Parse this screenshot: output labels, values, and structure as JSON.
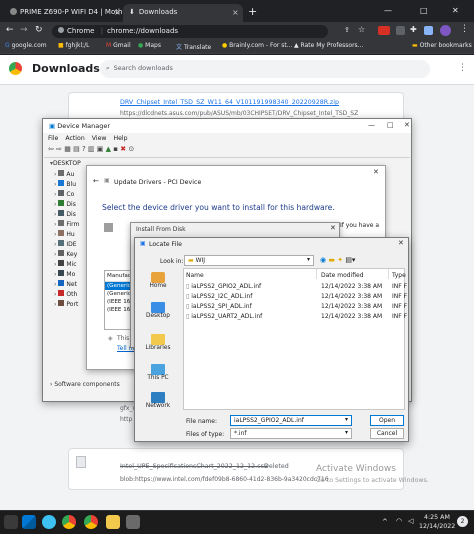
{
  "browser": {
    "tabs": [
      {
        "title": "PRIME Z690-P WIFI D4 | Mothe",
        "close": "×"
      },
      {
        "title": "Downloads",
        "close": "×"
      }
    ],
    "new_tab": "+",
    "window_controls": [
      "—",
      "□",
      "✕"
    ],
    "omnibox": {
      "chip": "Chrome",
      "url": "chrome://downloads"
    },
    "bookmarks": [
      "google.com",
      "fghjkl;/L",
      "Gmail",
      "Maps",
      "Translate",
      "Brainly.com - For st...",
      "Rate My Professors...",
      "Other bookmarks"
    ]
  },
  "downloads": {
    "title": "Downloads",
    "search_placeholder": "Search downloads",
    "item1": {
      "name": "DRV_Chipset_Intel_TSD_SZ_W11_64_V101191998340_20220928R.zip",
      "url": "https://dlcdnets.asus.com/pub/ASUS/mb/03CHIPSET/DRV_Chipset_Intel_TSD_SZ"
    },
    "item2": {
      "name": "Intel_UPE_SpecificationsChart_2022_12_12.csv",
      "status": "Deleted",
      "url": "blob:https://www.intel.com/fdef09b8-6860-41d2-836b-9a3420cdc716"
    },
    "partial_left_1": "gfx_w",
    "partial_left_2": "http"
  },
  "device_manager": {
    "title": "Device Manager",
    "menu": [
      "File",
      "Action",
      "View",
      "Help"
    ],
    "root": "DESKTOP",
    "tree": [
      "Au",
      "Blu",
      "Co",
      "Dis",
      "Dis",
      "Firm",
      "Hu",
      "IDE",
      "Key",
      "Mic",
      "Mo",
      "Net",
      "Oth",
      "Port"
    ],
    "bottom_item": "Software components"
  },
  "update_drivers": {
    "title": "Update Drivers - PCI Device",
    "heading": "Select the device driver you want to install for this hardware.",
    "side_text": "If you have a",
    "manufacturer_header": "Manufact",
    "manufacturers": [
      "(Generic",
      "(Generic",
      "(IEEE 16",
      "(IEEE 16"
    ],
    "note": "This d",
    "link": "Tell me"
  },
  "install_from_disk": {
    "title": "Install From Disk"
  },
  "locate_file": {
    "title": "Locate File",
    "look_in_label": "Look in:",
    "look_in_value": "WIJ",
    "columns": [
      "Name",
      "Date modified",
      "Type"
    ],
    "files": [
      {
        "name": "iaLPSS2_GPIO2_ADL.inf",
        "date": "12/14/2022 3:38 AM",
        "type": "INF F"
      },
      {
        "name": "iaLPSS2_I2C_ADL.inf",
        "date": "12/14/2022 3:38 AM",
        "type": "INF F"
      },
      {
        "name": "iaLPSS2_SPI_ADL.inf",
        "date": "12/14/2022 3:38 AM",
        "type": "INF F"
      },
      {
        "name": "iaLPSS2_UART2_ADL.inf",
        "date": "12/14/2022 3:38 AM",
        "type": "INF F"
      }
    ],
    "places": [
      "Home",
      "Desktop",
      "Libraries",
      "This PC",
      "Network"
    ],
    "file_name_label": "File name:",
    "file_name_value": "iaLPSS2_GPIO2_ADL.inf",
    "file_type_label": "Files of type:",
    "file_type_value": "*.inf",
    "open": "Open",
    "cancel": "Cancel"
  },
  "watermark": {
    "line1": "Activate Windows",
    "line2": "Go to Settings to activate Windows."
  },
  "taskbar": {
    "time": "4:25 AM",
    "date": "12/14/2022",
    "badge": "2"
  }
}
